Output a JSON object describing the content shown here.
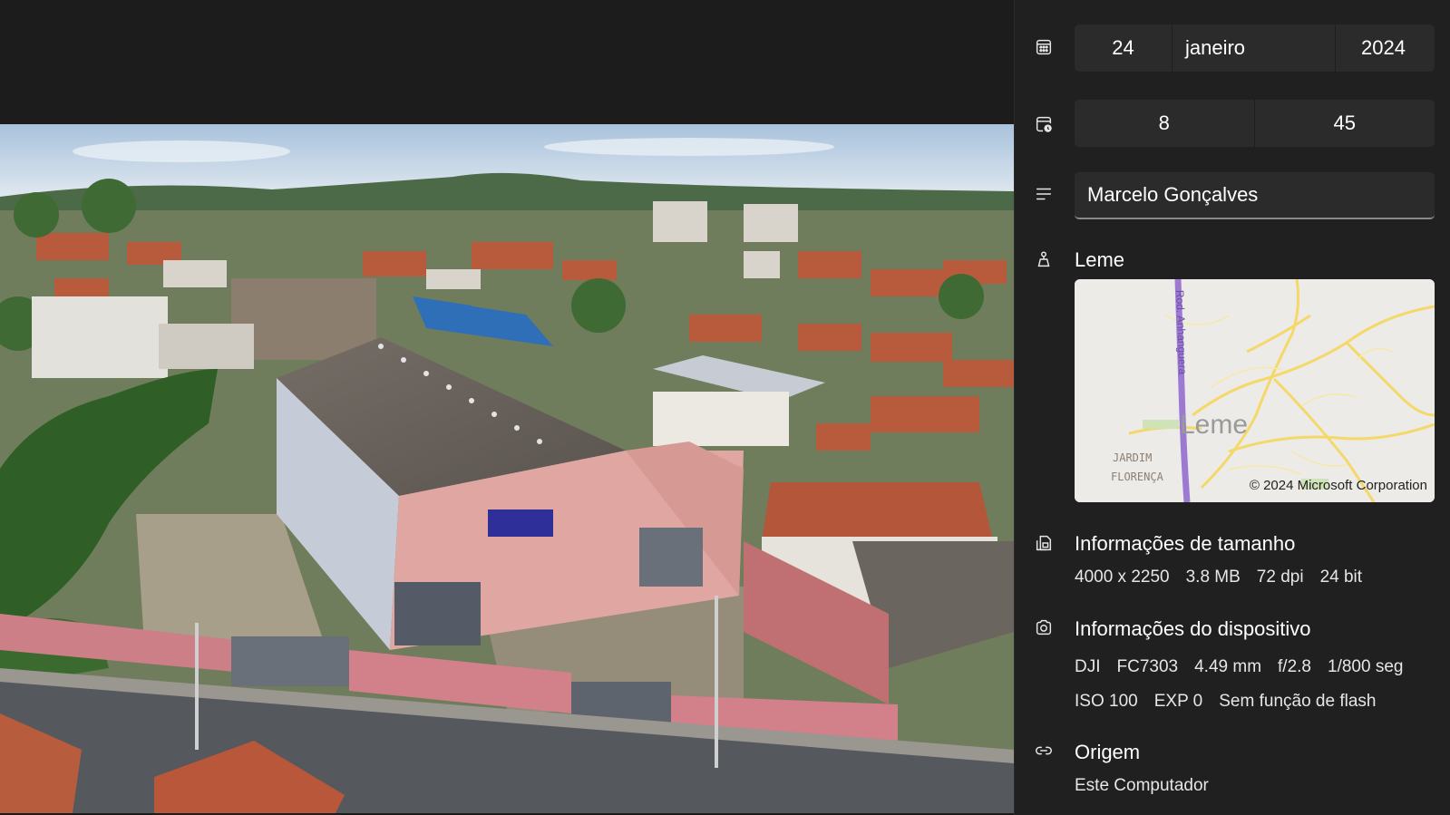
{
  "photo": {
    "alt": ""
  },
  "date": {
    "day": "24",
    "month": "janeiro",
    "year": "2024"
  },
  "time": {
    "hour": "8",
    "minute": "45"
  },
  "caption": {
    "value": "Marcelo Gonçalves"
  },
  "location": {
    "name": "Leme",
    "map_city": "Leme",
    "map_district_1": "JARDIM",
    "map_district_2": "FLORENÇA",
    "map_road": "Rod. Anhanguera",
    "copyright": "© 2024 Microsoft Corporation"
  },
  "size_info": {
    "title": "Informações de tamanho",
    "dimensions": "4000 x 2250",
    "filesize": "3.8 MB",
    "dpi": "72 dpi",
    "bitdepth": "24 bit"
  },
  "device_info": {
    "title": "Informações do dispositivo",
    "make": "DJI",
    "model": "FC7303",
    "focal": "4.49 mm",
    "aperture": "f/2.8",
    "shutter": "1/800 seg",
    "iso": "ISO 100",
    "exposure": "EXP 0",
    "flash": "Sem função de flash"
  },
  "origin": {
    "title": "Origem",
    "value": "Este Computador"
  },
  "colors": {
    "pane_bg": "#202020",
    "field_bg": "#2b2b2b",
    "viewer_bg": "#1c1c1c"
  }
}
